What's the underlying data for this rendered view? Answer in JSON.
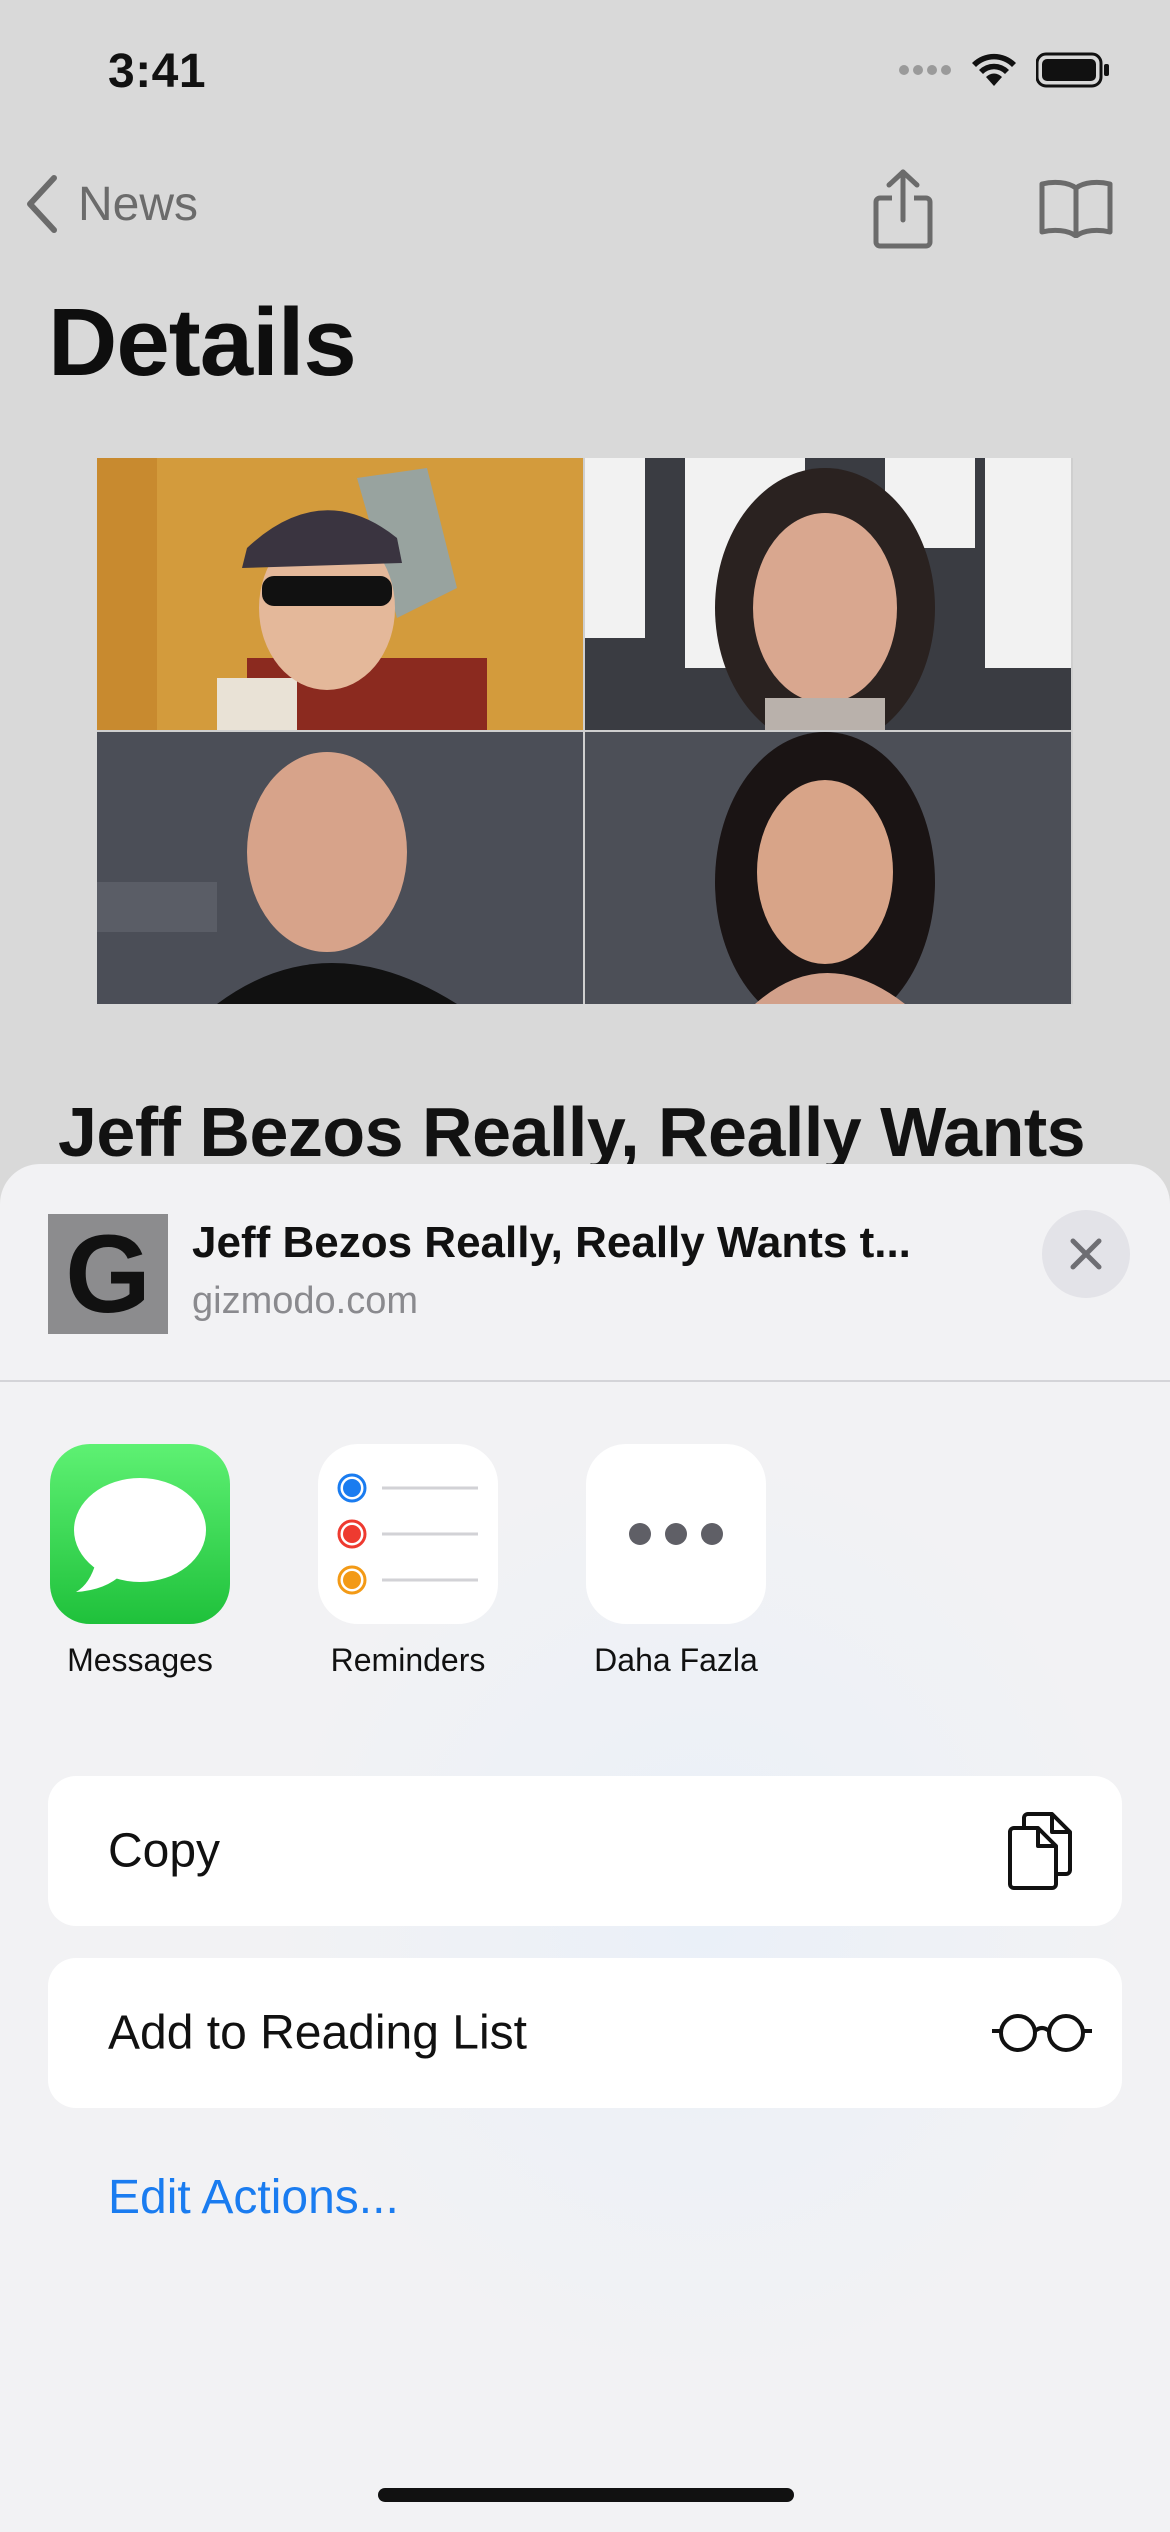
{
  "status_bar": {
    "time": "3:41"
  },
  "nav": {
    "back_label": "News"
  },
  "page": {
    "title": "Details",
    "headline": "Jeff Bezos Really, Really Wants"
  },
  "share_sheet": {
    "title": "Jeff Bezos Really, Really Wants t...",
    "domain": "gizmodo.com",
    "site_icon_letter": "G",
    "apps": [
      {
        "label": "Messages",
        "icon": "messages-icon"
      },
      {
        "label": "Reminders",
        "icon": "reminders-icon"
      },
      {
        "label": "Daha Fazla",
        "icon": "more-icon"
      }
    ],
    "actions": [
      {
        "label": "Copy",
        "icon": "copy-icon"
      },
      {
        "label": "Add to Reading List",
        "icon": "glasses-icon"
      }
    ],
    "edit_actions_label": "Edit Actions..."
  },
  "colors": {
    "accent": "#1a7cf0",
    "messages_green": "#27c940"
  }
}
